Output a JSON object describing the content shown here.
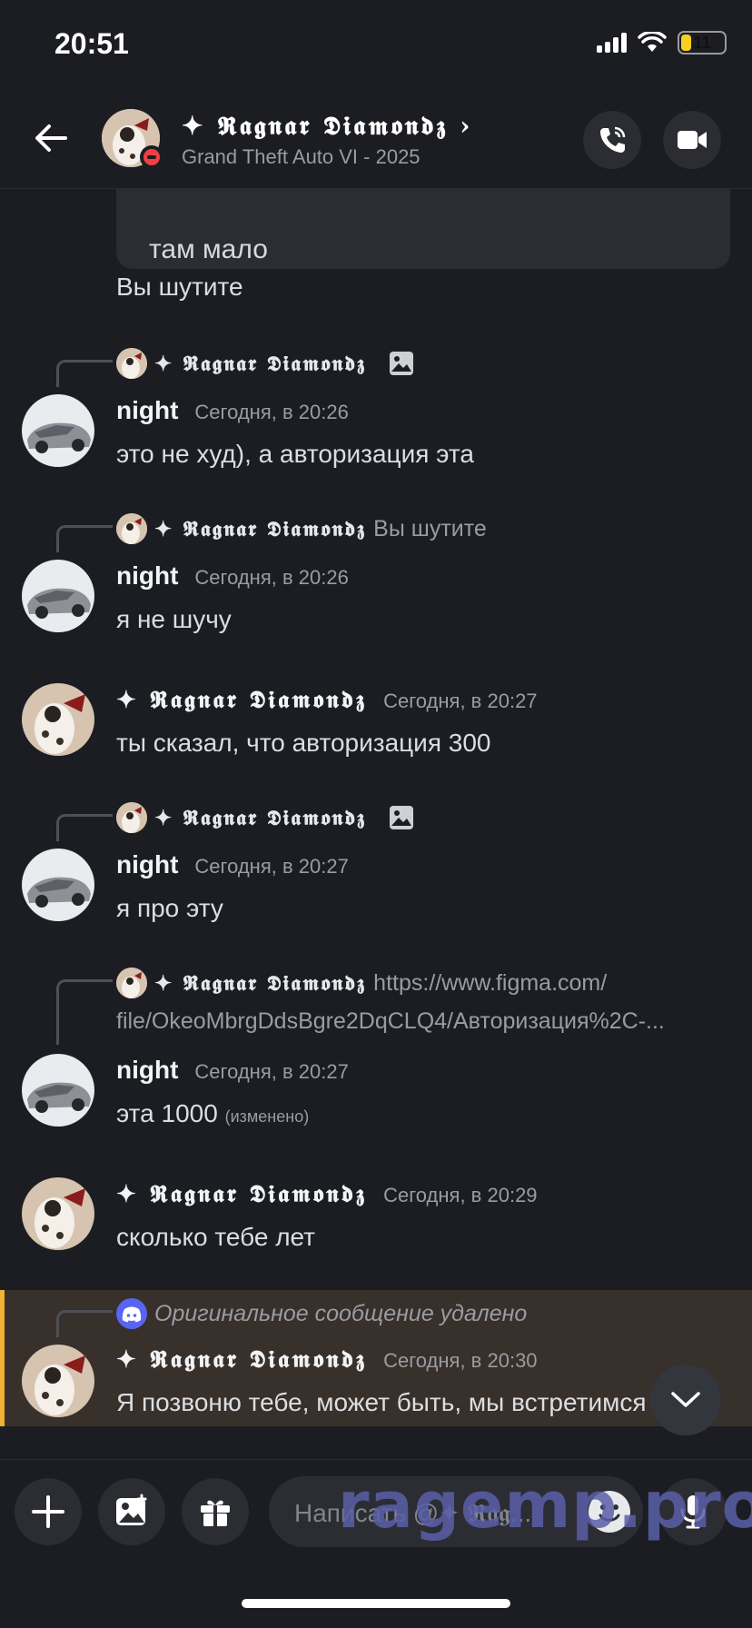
{
  "status_bar": {
    "time": "20:51",
    "battery": "11"
  },
  "header": {
    "name": "✦ 𝕽𝖆𝖌𝖓𝖆𝖗 𝕯𝖎𝖆𝖒𝖔𝖓𝖉𝖟 ›",
    "subtitle": "Grand Theft Auto VI - 2025"
  },
  "chat": {
    "embed_text": "там мало",
    "plain_line": "Вы шутите",
    "messages": [
      {
        "reply_name": "✦ 𝕽𝖆𝖌𝖓𝖆𝖗 𝕯𝖎𝖆𝖒𝖔𝖓𝖉𝖟",
        "reply_text": "",
        "author": "night",
        "time": "Сегодня, в 20:26",
        "body": "это не худ), а авторизация эта"
      },
      {
        "reply_name": "✦ 𝕽𝖆𝖌𝖓𝖆𝖗 𝕯𝖎𝖆𝖒𝖔𝖓𝖉𝖟",
        "reply_text": "Вы шутите",
        "author": "night",
        "time": "Сегодня, в 20:26",
        "body": "я не шучу"
      },
      {
        "author": "✦ 𝕽𝖆𝖌𝖓𝖆𝖗 𝕯𝖎𝖆𝖒𝖔𝖓𝖉𝖟",
        "time": "Сегодня, в 20:27",
        "body": "ты сказал, что  авторизация 300"
      },
      {
        "reply_name": "✦ 𝕽𝖆𝖌𝖓𝖆𝖗 𝕯𝖎𝖆𝖒𝖔𝖓𝖉𝖟",
        "reply_text": "",
        "author": "night",
        "time": "Сегодня, в 20:27",
        "body": "я про эту"
      },
      {
        "reply_name": "✦ 𝕽𝖆𝖌𝖓𝖆𝖗 𝕯𝖎𝖆𝖒𝖔𝖓𝖉𝖟",
        "reply_text": "https://www.figma.com/",
        "reply_text_2": "file/OkeoMbrgDdsBgre2DqCLQ4/Авторизация%2C-...",
        "author": "night",
        "time": "Сегодня, в 20:27",
        "body": "эта 1000",
        "edited": "(изменено)"
      },
      {
        "author": "✦ 𝕽𝖆𝖌𝖓𝖆𝖗 𝕯𝖎𝖆𝖒𝖔𝖓𝖉𝖟",
        "time": "Сегодня, в 20:29",
        "body": "сколько тебе лет"
      },
      {
        "reply_text": "Оригинальное сообщение удалено",
        "author": "✦ 𝕽𝖆𝖌𝖓𝖆𝖗 𝕯𝖎𝖆𝖒𝖔𝖓𝖉𝖟",
        "time": "Сегодня, в 20:30",
        "body": "Я позвоню тебе, может быть, мы встретимся"
      }
    ]
  },
  "composer": {
    "placeholder": "Написать @✦ 𝕽𝖆𝖌..."
  },
  "watermark": "ragemp.pro",
  "colors": {
    "background": "#1c1d22",
    "highlight": "#38302a",
    "highlight_bar": "#f0b232",
    "discord_blurple": "#5865f2"
  }
}
